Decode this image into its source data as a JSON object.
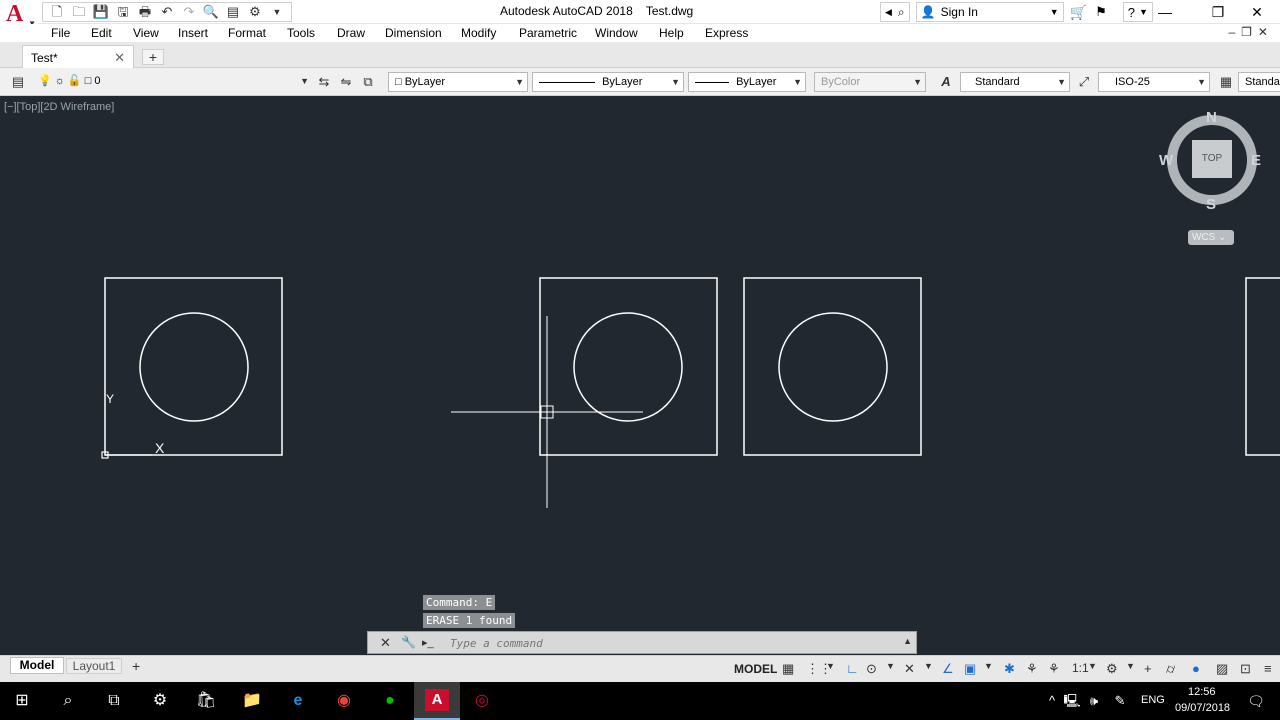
{
  "window": {
    "title": "Autodesk AutoCAD 2018    Test.dwg",
    "sign_in": "Sign In",
    "minimize": "—",
    "maximize": "❐",
    "close": "✕"
  },
  "app_logo": "A",
  "menus": [
    "File",
    "Edit",
    "View",
    "Insert",
    "Format",
    "Tools",
    "Draw",
    "Dimension",
    "Modify",
    "Parametric",
    "Window",
    "Help",
    "Express"
  ],
  "document_tabs": {
    "active": "Test*",
    "close": "✕",
    "add": "+"
  },
  "toolbar": {
    "layer": "0",
    "color": "ByLayer",
    "linetype": "ByLayer",
    "lineweight": "ByLayer",
    "plotstyle": "ByColor",
    "text_style": "Standard",
    "dim_style": "ISO-25",
    "table_style": "Standar"
  },
  "viewport_label": "[−][Top][2D Wireframe]",
  "viewcube": {
    "n": "N",
    "s": "S",
    "e": "E",
    "w": "W",
    "face": "TOP",
    "wcs": "WCS ⌄"
  },
  "ucs": {
    "x": "X",
    "y": "Y"
  },
  "command_history": [
    "Command: E",
    "ERASE 1 found"
  ],
  "command_line": {
    "placeholder": "Type a command",
    "prompt": "▸_"
  },
  "layout_tabs": {
    "model": "Model",
    "layout1": "Layout1",
    "add": "+"
  },
  "status_bar": {
    "model": "MODEL",
    "scale": "1:1"
  },
  "taskbar": {
    "lang": "ENG",
    "time": "12:56",
    "date": "09/07/2018"
  },
  "colors": {
    "canvas_bg": "#212830",
    "drawing_lines": "#ffffff",
    "autocad_red": "#c8102e"
  }
}
